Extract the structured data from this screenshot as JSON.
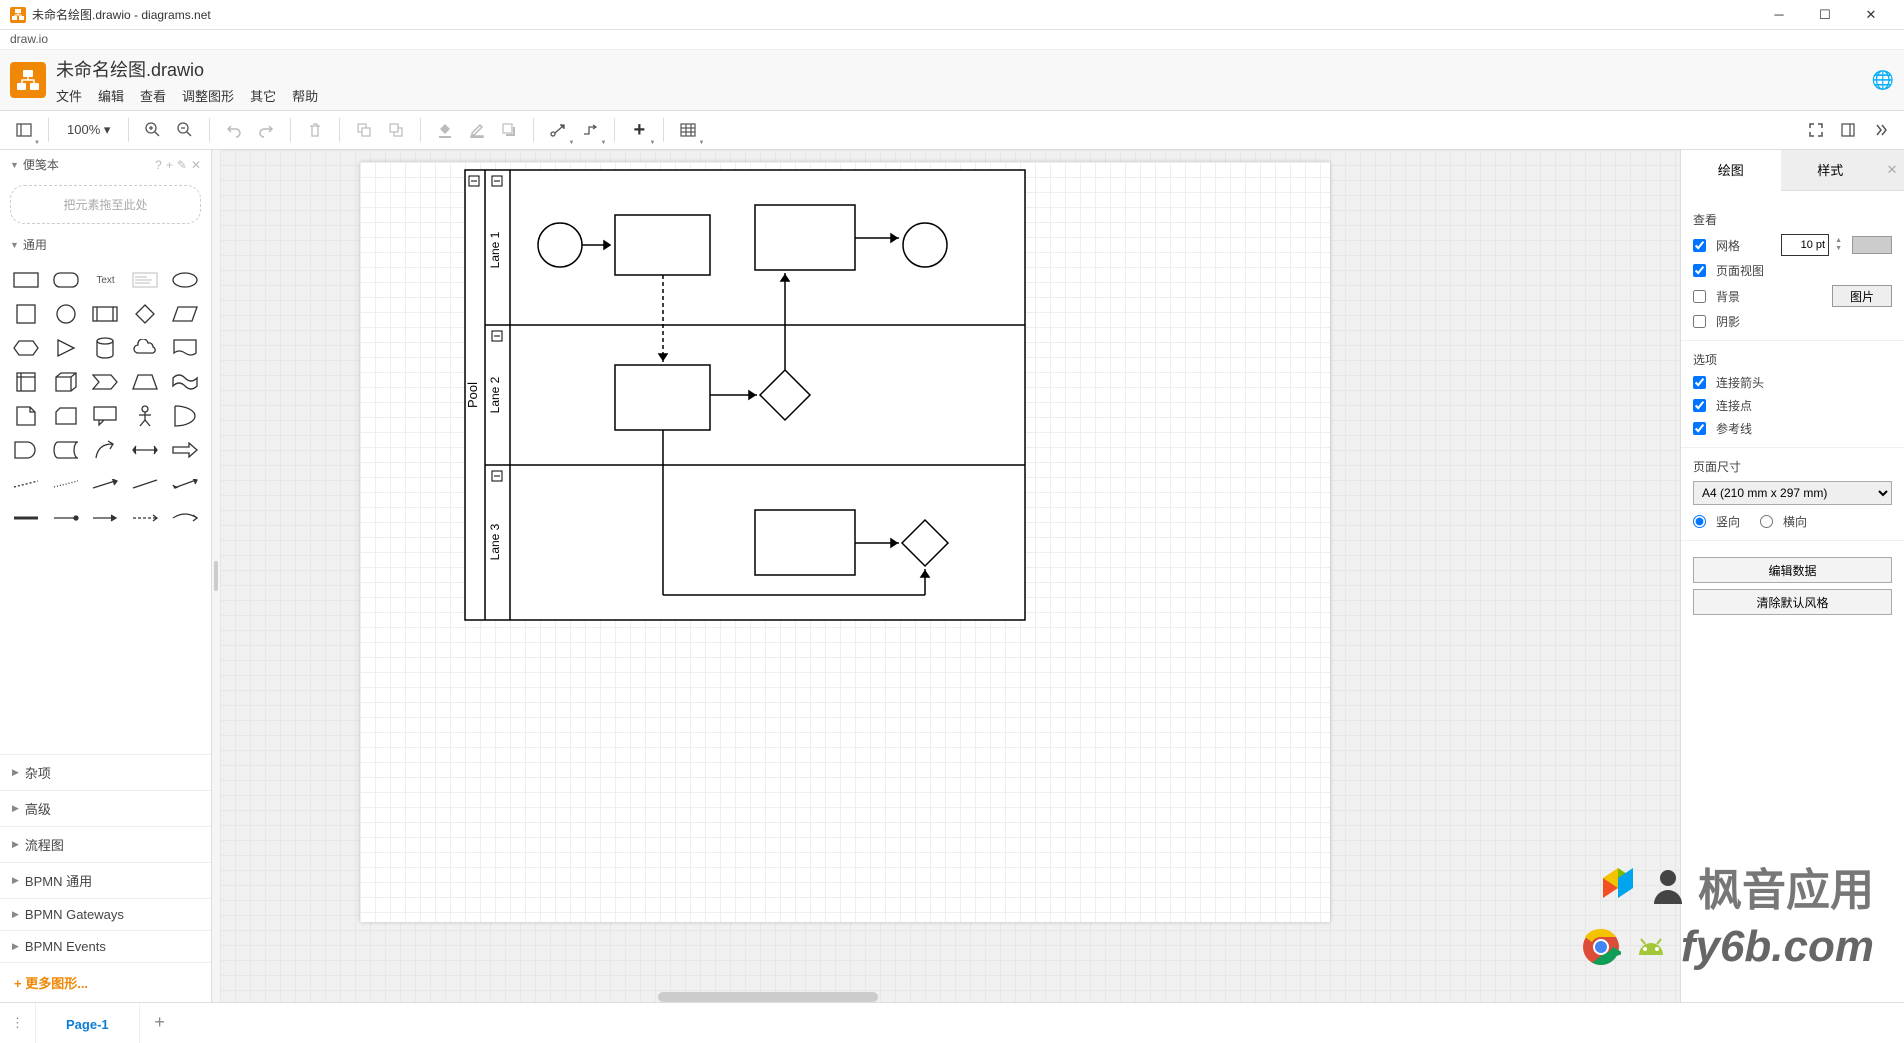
{
  "window": {
    "title": "未命名绘图.drawio - diagrams.net"
  },
  "subbar": "draw.io",
  "doc_title": "未命名绘图.drawio",
  "menu": {
    "file": "文件",
    "edit": "编辑",
    "view": "查看",
    "arrange": "调整图形",
    "extras": "其它",
    "help": "帮助"
  },
  "toolbar": {
    "zoom": "100%"
  },
  "sidebar": {
    "scratchpad_title": "便笺本",
    "drop_hint": "把元素拖至此处",
    "general_title": "通用",
    "categories": [
      "杂项",
      "高级",
      "流程图",
      "BPMN 通用",
      "BPMN Gateways",
      "BPMN Events"
    ],
    "more_shapes": "+ 更多图形..."
  },
  "canvas": {
    "pool_label": "Pool",
    "lanes": [
      "Lane 1",
      "Lane 2",
      "Lane 3"
    ]
  },
  "right_panel": {
    "tab_diagram": "绘图",
    "tab_style": "样式",
    "view_title": "查看",
    "grid_label": "网格",
    "grid_value": "10 pt",
    "page_view": "页面视图",
    "background": "背景",
    "image_btn": "图片",
    "shadow": "阴影",
    "options_title": "选项",
    "conn_arrows": "连接箭头",
    "conn_points": "连接点",
    "guides": "参考线",
    "page_size_title": "页面尺寸",
    "page_size_value": "A4 (210 mm x 297 mm)",
    "portrait": "竖向",
    "landscape": "横向",
    "edit_data": "编辑数据",
    "reset_style": "清除默认风格"
  },
  "pages": {
    "current": "Page-1"
  },
  "watermark": {
    "line1": "枫音应用",
    "line2": "fy6b.com"
  }
}
